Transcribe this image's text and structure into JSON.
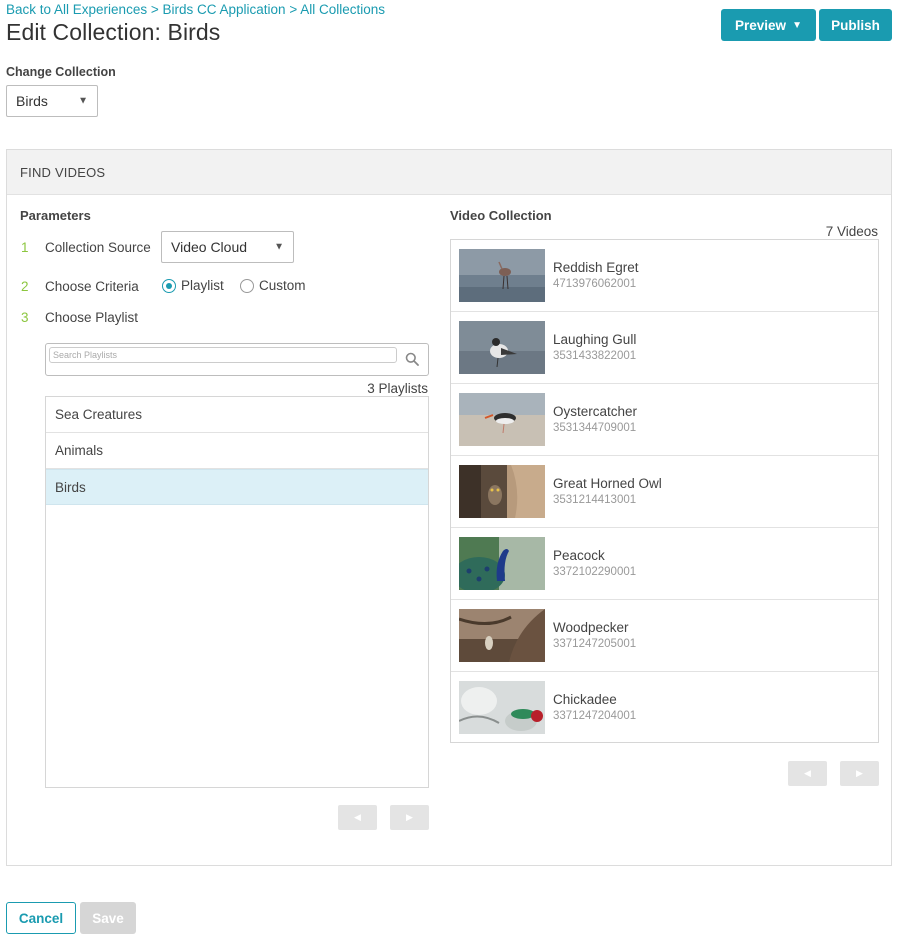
{
  "breadcrumb": {
    "items": [
      "Back to All Experiences",
      "Birds CC Application",
      "All Collections"
    ],
    "separator": ">"
  },
  "page_title": "Edit Collection: Birds",
  "header_buttons": {
    "preview": "Preview",
    "preview_caret": "▼",
    "publish": "Publish"
  },
  "change_collection": {
    "label": "Change Collection",
    "selected": "Birds",
    "arrow": "▼"
  },
  "find_videos": {
    "header": "FIND VIDEOS",
    "parameters": {
      "title": "Parameters",
      "steps": [
        {
          "num": "1",
          "label": "Collection Source"
        },
        {
          "num": "2",
          "label": "Choose Criteria"
        },
        {
          "num": "3",
          "label": "Choose Playlist"
        }
      ],
      "source_selected": "Video Cloud",
      "criteria_options": [
        {
          "label": "Playlist",
          "checked": true
        },
        {
          "label": "Custom",
          "checked": false
        }
      ],
      "search_placeholder": "Search Playlists",
      "playlist_count": "3 Playlists",
      "playlists": [
        {
          "label": "Sea Creatures",
          "selected": false
        },
        {
          "label": "Animals",
          "selected": false
        },
        {
          "label": "Birds",
          "selected": true
        }
      ]
    },
    "video_collection": {
      "title": "Video Collection",
      "count": "7 Videos",
      "videos": [
        {
          "name": "Reddish Egret",
          "id": "4713976062001"
        },
        {
          "name": "Laughing Gull",
          "id": "3531433822001"
        },
        {
          "name": "Oystercatcher",
          "id": "3531344709001"
        },
        {
          "name": "Great Horned Owl",
          "id": "3531214413001"
        },
        {
          "name": "Peacock",
          "id": "3372102290001"
        },
        {
          "name": "Woodpecker",
          "id": "3371247205001"
        },
        {
          "name": "Chickadee",
          "id": "3371247204001"
        }
      ]
    },
    "pager": {
      "prev": "◀",
      "next": "▶"
    }
  },
  "footer": {
    "cancel": "Cancel",
    "save": "Save"
  },
  "colors": {
    "accent": "#1a9bb0",
    "step_number": "#8cc63f",
    "selected_row": "#dcf0f7",
    "disabled": "#d6d6d6"
  }
}
